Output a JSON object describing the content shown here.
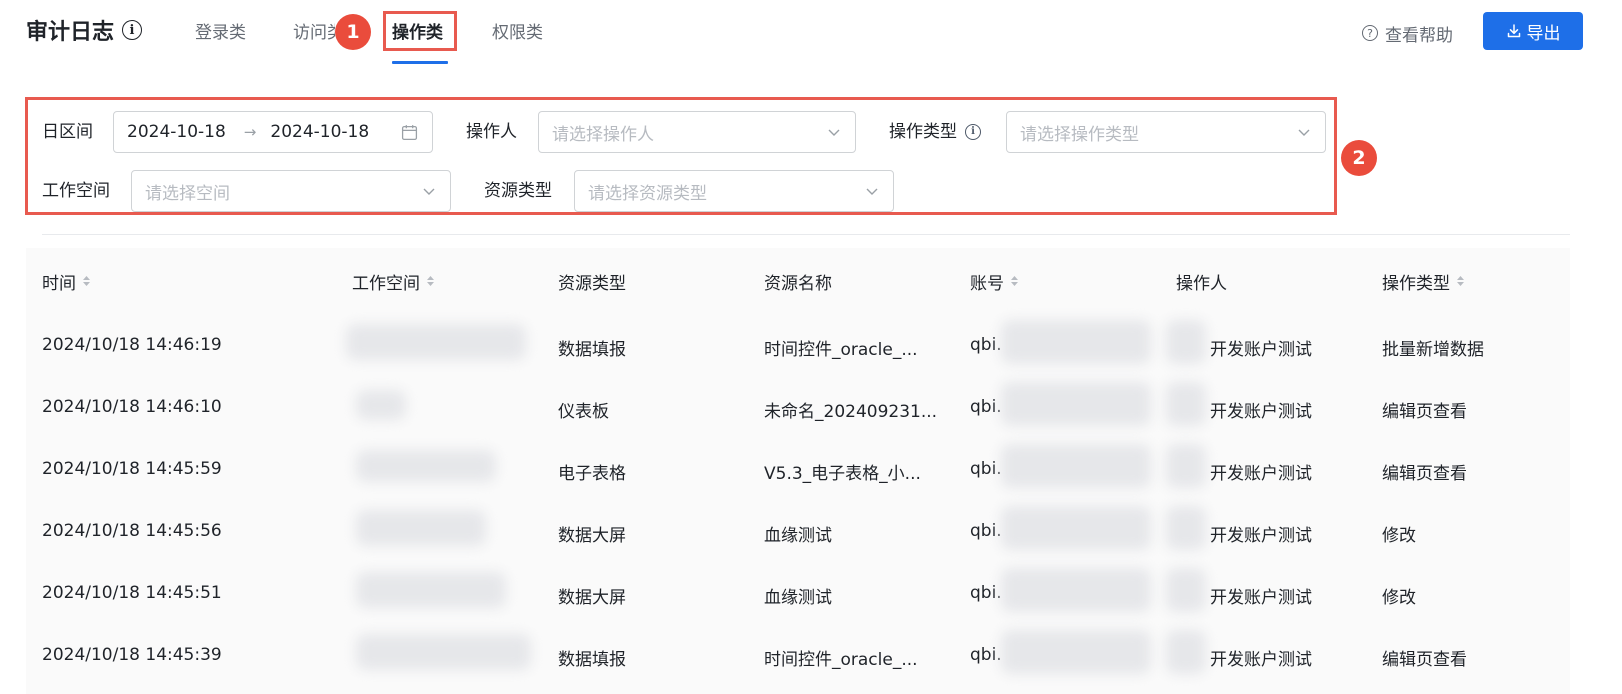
{
  "header": {
    "title": "审计日志",
    "tabs": [
      {
        "label": "登录类"
      },
      {
        "label": "访问类"
      },
      {
        "label": "操作类"
      },
      {
        "label": "权限类"
      }
    ],
    "help_label": "查看帮助",
    "export_label": "导出"
  },
  "badges": {
    "one": "1",
    "two": "2"
  },
  "filters": {
    "date_label": "日区间",
    "date_start": "2024-10-18",
    "date_end": "2024-10-18",
    "date_separator": "→",
    "operator_label": "操作人",
    "operator_placeholder": "请选择操作人",
    "op_type_label": "操作类型",
    "op_type_placeholder": "请选择操作类型",
    "workspace_label": "工作空间",
    "workspace_placeholder": "请选择空间",
    "resource_type_label": "资源类型",
    "resource_type_placeholder": "请选择资源类型"
  },
  "table": {
    "columns": [
      "时间",
      "工作空间",
      "资源类型",
      "资源名称",
      "账号",
      "操作人",
      "操作类型"
    ],
    "rows": [
      {
        "time": "2024/10/18 14:46:19",
        "resource_type": "数据填报",
        "resource_name": "时间控件_oracle_...",
        "account": "qbi.",
        "operator": "开发账户测试",
        "op_type": "批量新增数据"
      },
      {
        "time": "2024/10/18 14:46:10",
        "resource_type": "仪表板",
        "resource_name": "未命名_202409231...",
        "account": "qbi.",
        "operator": "开发账户测试",
        "op_type": "编辑页查看"
      },
      {
        "time": "2024/10/18 14:45:59",
        "resource_type": "电子表格",
        "resource_name": "V5.3_电子表格_小...",
        "account": "qbi.",
        "operator": "开发账户测试",
        "op_type": "编辑页查看"
      },
      {
        "time": "2024/10/18 14:45:56",
        "resource_type": "数据大屏",
        "resource_name": "血缘测试",
        "account": "qbi.",
        "operator": "开发账户测试",
        "op_type": "修改"
      },
      {
        "time": "2024/10/18 14:45:51",
        "resource_type": "数据大屏",
        "resource_name": "血缘测试",
        "account": "qbi.",
        "operator": "开发账户测试",
        "op_type": "修改"
      },
      {
        "time": "2024/10/18 14:45:39",
        "resource_type": "数据填报",
        "resource_name": "时间控件_oracle_...",
        "account": "qbi.",
        "operator": "开发账户测试",
        "op_type": "编辑页查看"
      }
    ]
  },
  "colors": {
    "accent": "#1e6fe8",
    "highlight": "#e85a4f",
    "badge": "#ea4c3c"
  }
}
